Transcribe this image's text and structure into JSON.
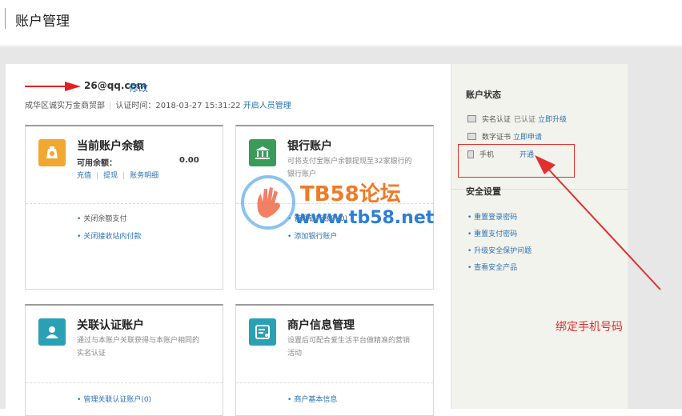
{
  "page_title": "账户管理",
  "account": {
    "email_suffix": "26@qq.com",
    "edit_label": "修改",
    "company": "成华区诚实万金商贸部",
    "auth_time": "认证时间：2018-03-27 15:31:22",
    "open_staff": "开启人员管理"
  },
  "cards": {
    "balance": {
      "title": "当前账户余额",
      "label": "可用余额：",
      "value": "0.00",
      "actions": [
        "充值",
        "提现",
        "账务明细"
      ],
      "links": [
        "关闭余额支付",
        "关闭接收站内付款"
      ]
    },
    "bank": {
      "title": "银行账户",
      "desc": "可将支付宝账户余额提现至32家银行的银行账户",
      "links": [
        "管理银行账户(0)",
        "添加银行账户"
      ]
    },
    "linked": {
      "title": "关联认证账户",
      "desc": "通过与本账户关联获得与本账户相同的实名认证",
      "links": [
        "管理关联认证账户(0)"
      ]
    },
    "merchant": {
      "title": "商户信息管理",
      "desc": "设置后可配合爱生活平台做精准的营销活动",
      "links": [
        "商户基本信息"
      ]
    }
  },
  "sidebar": {
    "status_title": "账户状态",
    "rows": [
      {
        "label": "实名认证",
        "value": "已认证",
        "link": "立即升级"
      },
      {
        "label": "数字证书",
        "value": "",
        "link": "立即申请"
      },
      {
        "label": "手机",
        "value": "",
        "link": "开通"
      }
    ],
    "security_title": "安全设置",
    "security_links": [
      "重置登录密码",
      "重置支付密码",
      "升级安全保护问题",
      "查看安全产品"
    ]
  },
  "annotation": "绑定手机号码",
  "watermark": {
    "line1": "TB58论坛",
    "line2": "www.tb58.net"
  },
  "colors": {
    "link": "#2b72b5",
    "annotation": "#e03030",
    "wallet": "#f0a830",
    "bank": "#3a9a5a",
    "linked": "#2aa0b5",
    "merchant": "#2aa0b5"
  }
}
